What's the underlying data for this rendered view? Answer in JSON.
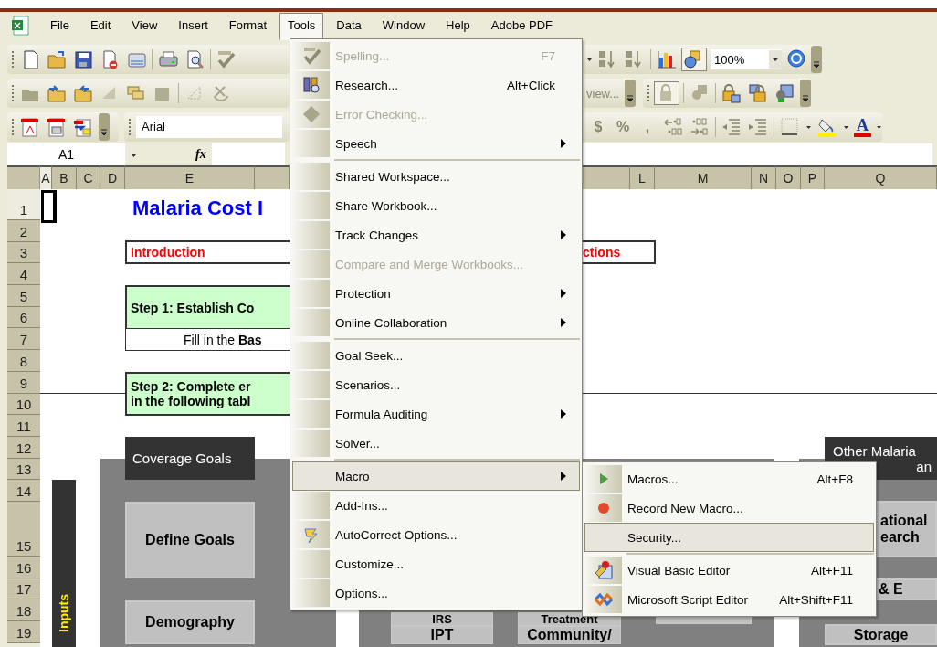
{
  "menu_bar": {
    "items": [
      {
        "label": "File",
        "selected": false
      },
      {
        "label": "Edit",
        "selected": false
      },
      {
        "label": "View",
        "selected": false
      },
      {
        "label": "Insert",
        "selected": false
      },
      {
        "label": "Format",
        "selected": false
      },
      {
        "label": "Tools",
        "selected": true
      },
      {
        "label": "Data",
        "selected": false
      },
      {
        "label": "Window",
        "selected": false
      },
      {
        "label": "Help",
        "selected": false
      },
      {
        "label": "Adobe PDF",
        "selected": false
      }
    ]
  },
  "toolbars": {
    "drawing_on": true,
    "protect_on": true,
    "review_fragment": "view...",
    "zoom": "100%",
    "font": "Arial",
    "number_glyphs": [
      "$",
      "%",
      ","
    ],
    "font_color_glyph": "A"
  },
  "formula_bar": {
    "name_box": "A1",
    "function_label": "fx"
  },
  "sheet": {
    "column_headers": [
      {
        "label": "A",
        "selected": true
      },
      {
        "label": "B",
        "selected": false
      },
      {
        "label": "C",
        "selected": false
      },
      {
        "label": "D",
        "selected": false
      },
      {
        "label": "E",
        "selected": false
      },
      {
        "label": "L",
        "selected": false
      },
      {
        "label": "M",
        "selected": false
      },
      {
        "label": "N",
        "selected": false
      },
      {
        "label": "O",
        "selected": false
      },
      {
        "label": "P",
        "selected": false
      },
      {
        "label": "Q",
        "selected": false
      }
    ],
    "row_headers": [
      {
        "label": "1",
        "selected": true
      },
      {
        "label": "2",
        "selected": false
      },
      {
        "label": "3",
        "selected": false
      },
      {
        "label": "4",
        "selected": false
      },
      {
        "label": "5",
        "selected": false
      },
      {
        "label": "6",
        "selected": false
      },
      {
        "label": "7",
        "selected": false
      },
      {
        "label": "8",
        "selected": false
      },
      {
        "label": "9",
        "selected": false
      },
      {
        "label": "10",
        "selected": false
      },
      {
        "label": "11",
        "selected": false
      },
      {
        "label": "12",
        "selected": false
      },
      {
        "label": "13",
        "selected": false
      },
      {
        "label": "14",
        "selected": false
      },
      {
        "label": "15",
        "selected": false
      },
      {
        "label": "16",
        "selected": false
      },
      {
        "label": "17",
        "selected": false
      },
      {
        "label": "18",
        "selected": false
      },
      {
        "label": "19",
        "selected": false
      }
    ],
    "shapes": [
      {
        "kind": "title",
        "lines": [
          "Malaria Cost I"
        ]
      },
      {
        "kind": "outlined",
        "lines": [
          "Introduction"
        ]
      },
      {
        "kind": "outlined",
        "lines": [
          "ctions"
        ]
      },
      {
        "kind": "step",
        "lines": [
          "Step 1: Establish Co"
        ]
      },
      {
        "kind": "note",
        "lines": [
          "Fill in the **Bas**"
        ]
      },
      {
        "kind": "step",
        "lines": [
          "Step 2: Complete er",
          "in the following tabl"
        ]
      },
      {
        "kind": "header",
        "lines": [
          "Coverage Goals"
        ]
      },
      {
        "kind": "side_bar",
        "lines": [
          "Inputs"
        ]
      },
      {
        "kind": "box",
        "lines": [
          "Define Goals"
        ]
      },
      {
        "kind": "box",
        "lines": [
          "Demography"
        ]
      },
      {
        "kind": "box",
        "lines": [
          "IRS"
        ]
      },
      {
        "kind": "box",
        "lines": [
          "IPT"
        ]
      },
      {
        "kind": "box",
        "lines": [
          "Treatment"
        ]
      },
      {
        "kind": "box",
        "lines": [
          "Community/"
        ]
      },
      {
        "kind": "box"
      },
      {
        "kind": "header",
        "lines": [
          "Other Malaria",
          "an"
        ]
      },
      {
        "kind": "box",
        "lines": [
          "ational",
          "earch"
        ]
      },
      {
        "kind": "box",
        "lines": [
          "& E"
        ]
      },
      {
        "kind": "box",
        "lines": [
          "Storage"
        ]
      }
    ]
  },
  "tools_menu": {
    "items": [
      {
        "kind": "item",
        "label": "Spelling...",
        "shortcut": "F7",
        "disabled": true,
        "submenu": false,
        "selected": false
      },
      {
        "kind": "item",
        "label": "Research...",
        "shortcut": "Alt+Click",
        "disabled": false,
        "submenu": false,
        "selected": false
      },
      {
        "kind": "item",
        "label": "Error Checking...",
        "disabled": true,
        "submenu": false,
        "selected": false
      },
      {
        "kind": "item",
        "label": "Speech",
        "disabled": false,
        "submenu": true,
        "selected": false
      },
      {
        "kind": "separator"
      },
      {
        "kind": "item",
        "label": "Shared Workspace...",
        "disabled": false,
        "submenu": false,
        "selected": false
      },
      {
        "kind": "item",
        "label": "Share Workbook...",
        "disabled": false,
        "submenu": false,
        "selected": false
      },
      {
        "kind": "item",
        "label": "Track Changes",
        "disabled": false,
        "submenu": true,
        "selected": false
      },
      {
        "kind": "item",
        "label": "Compare and Merge Workbooks...",
        "disabled": true,
        "submenu": false,
        "selected": false
      },
      {
        "kind": "item",
        "label": "Protection",
        "disabled": false,
        "submenu": true,
        "selected": false
      },
      {
        "kind": "item",
        "label": "Online Collaboration",
        "disabled": false,
        "submenu": true,
        "selected": false
      },
      {
        "kind": "separator"
      },
      {
        "kind": "item",
        "label": "Goal Seek...",
        "disabled": false,
        "submenu": false,
        "selected": false
      },
      {
        "kind": "item",
        "label": "Scenarios...",
        "disabled": false,
        "submenu": false,
        "selected": false
      },
      {
        "kind": "item",
        "label": "Formula Auditing",
        "disabled": false,
        "submenu": true,
        "selected": false
      },
      {
        "kind": "item",
        "label": "Solver...",
        "disabled": false,
        "submenu": false,
        "selected": false
      },
      {
        "kind": "separator"
      },
      {
        "kind": "item",
        "label": "Macro",
        "disabled": false,
        "submenu": true,
        "selected": true
      },
      {
        "kind": "item",
        "label": "Add-Ins...",
        "disabled": false,
        "submenu": false,
        "selected": false
      },
      {
        "kind": "item",
        "label": "AutoCorrect Options...",
        "disabled": false,
        "submenu": false,
        "selected": false
      },
      {
        "kind": "item",
        "label": "Customize...",
        "disabled": false,
        "submenu": false,
        "selected": false
      },
      {
        "kind": "item",
        "label": "Options...",
        "disabled": false,
        "submenu": false,
        "selected": false
      }
    ]
  },
  "macro_submenu": {
    "items": [
      {
        "kind": "item",
        "label": "Macros...",
        "shortcut": "Alt+F8",
        "selected": false
      },
      {
        "kind": "item",
        "label": "Record New Macro...",
        "selected": false
      },
      {
        "kind": "item",
        "label": "Security...",
        "selected": true
      },
      {
        "kind": "separator"
      },
      {
        "kind": "item",
        "label": "Visual Basic Editor",
        "shortcut": "Alt+F11",
        "selected": false
      },
      {
        "kind": "item",
        "label": "Microsoft Script Editor",
        "shortcut": "Alt+Shift+F11",
        "selected": false
      }
    ]
  }
}
